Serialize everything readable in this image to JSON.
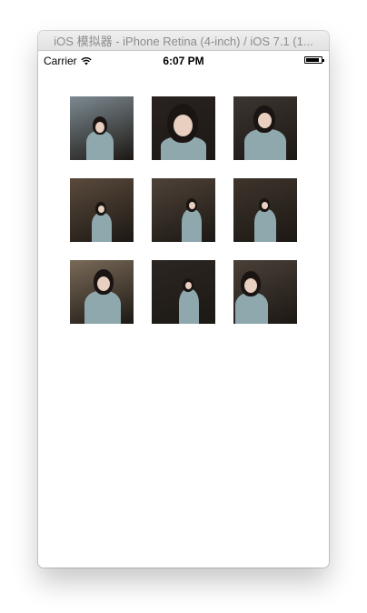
{
  "window": {
    "title": "iOS 模拟器 - iPhone Retina (4-inch) / iOS 7.1 (1..."
  },
  "status_bar": {
    "carrier": "Carrier",
    "time": "6:07 PM",
    "wifi_icon": "wifi-icon",
    "battery_icon": "battery-icon",
    "battery_level": 0.9
  },
  "photos": [
    {
      "id": "photo-1",
      "scene": "outdoor railing, person walking",
      "bg": "#7d8a91"
    },
    {
      "id": "photo-2",
      "scene": "close-up portrait, dark background",
      "bg": "#2a2220"
    },
    {
      "id": "photo-3",
      "scene": "portrait with hand heart gesture",
      "bg": "#3c3530"
    },
    {
      "id": "photo-4",
      "scene": "indoor shop, standing",
      "bg": "#5a4a3c"
    },
    {
      "id": "photo-5",
      "scene": "indoor shop, standing near shelves",
      "bg": "#4e4238"
    },
    {
      "id": "photo-6",
      "scene": "indoor shop, seated",
      "bg": "#3e342c"
    },
    {
      "id": "photo-7",
      "scene": "bookshelf background portrait",
      "bg": "#7a6a58"
    },
    {
      "id": "photo-8",
      "scene": "indoor dim light portrait",
      "bg": "#2c2622"
    },
    {
      "id": "photo-9",
      "scene": "shop portrait holding item",
      "bg": "#4a4038"
    }
  ]
}
